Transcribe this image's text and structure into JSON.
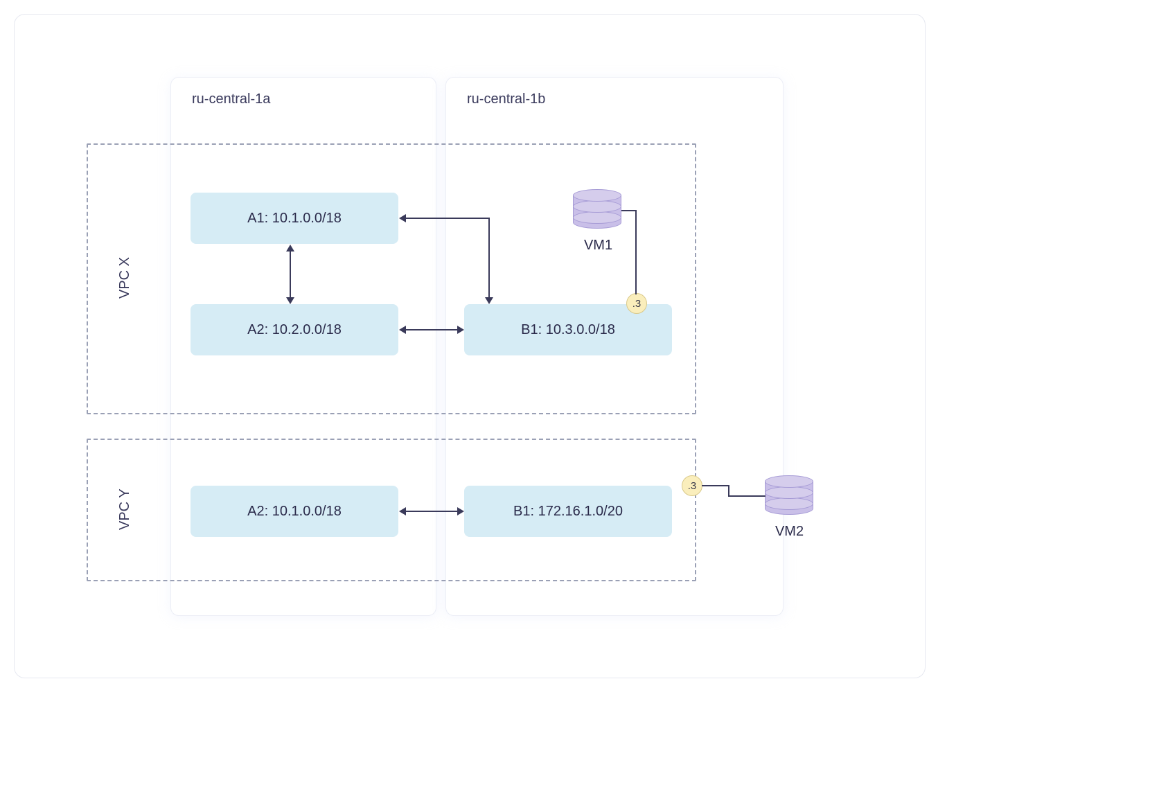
{
  "zones": {
    "a": {
      "title": "ru-central-1a"
    },
    "b": {
      "title": "ru-central-1b"
    }
  },
  "vpcs": {
    "x": {
      "label": "VPC X"
    },
    "y": {
      "label": "VPC Y"
    }
  },
  "subnets": {
    "a1": {
      "label": "A1: 10.1.0.0/18"
    },
    "a2x": {
      "label": "A2: 10.2.0.0/18"
    },
    "b1x": {
      "label": "B1: 10.3.0.0/18"
    },
    "a2y": {
      "label": "A2: 10.1.0.0/18"
    },
    "b1y": {
      "label": "B1: 172.16.1.0/20"
    }
  },
  "vms": {
    "vm1": {
      "label": "VM1",
      "endpoint": ".3"
    },
    "vm2": {
      "label": "VM2",
      "endpoint": ".3"
    }
  }
}
